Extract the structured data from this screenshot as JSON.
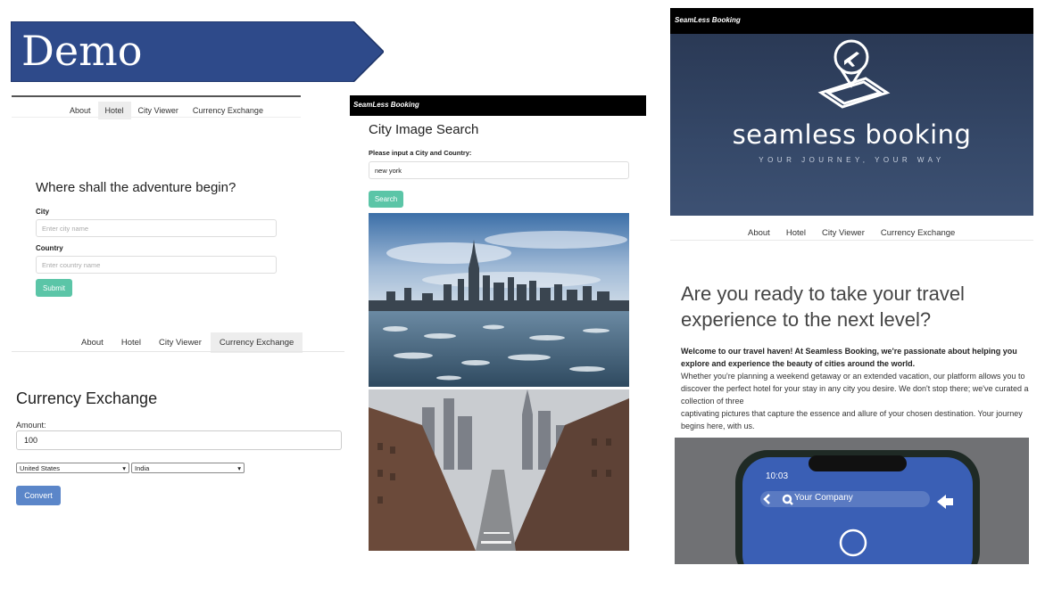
{
  "banner": {
    "title": "Demo",
    "color": "#2e4a8a"
  },
  "hotel_page": {
    "nav": [
      "About",
      "Hotel",
      "City Viewer",
      "Currency Exchange"
    ],
    "active_nav": 1,
    "heading": "Where shall the adventure begin?",
    "city_label": "City",
    "city_placeholder": "Enter city name",
    "country_label": "Country",
    "country_placeholder": "Enter country name",
    "submit_label": "Submit"
  },
  "currency_page": {
    "nav": [
      "About",
      "Hotel",
      "City Viewer",
      "Currency Exchange"
    ],
    "active_nav": 3,
    "heading": "Currency Exchange",
    "amount_label": "Amount:",
    "amount_value": "100",
    "from_country": "United States",
    "to_country": "India",
    "convert_label": "Convert"
  },
  "city_page": {
    "brand": "SeamLess Booking",
    "heading": "City Image Search",
    "prompt": "Please input a City and Country:",
    "query": "new york",
    "search_label": "Search"
  },
  "about_page": {
    "brand": "SeamLess Booking",
    "hero_title": "seamless booking",
    "hero_tagline": "YOUR JOURNEY, YOUR WAY",
    "nav": [
      "About",
      "Hotel",
      "City Viewer",
      "Currency Exchange"
    ],
    "heading": "Are you ready to take your travel experience to the next level?",
    "intro": "Welcome to our travel haven! At Seamless Booking, we're passionate about helping you explore and experience the beauty of cities around the world.",
    "body1": "Whether you're planning a weekend getaway or an extended vacation, our platform allows you to discover the perfect hotel for your stay in any city you desire. We don't stop there; we've curated a collection of three",
    "body2": "captivating pictures that capture the essence and allure of your chosen destination. Your journey begins here, with us.",
    "phone_time": "10:03",
    "phone_url": "Your Company"
  },
  "colors": {
    "accent_green": "#5bc5a7",
    "convert_blue": "#5b86c9",
    "hero_navy": "#2f4060"
  }
}
